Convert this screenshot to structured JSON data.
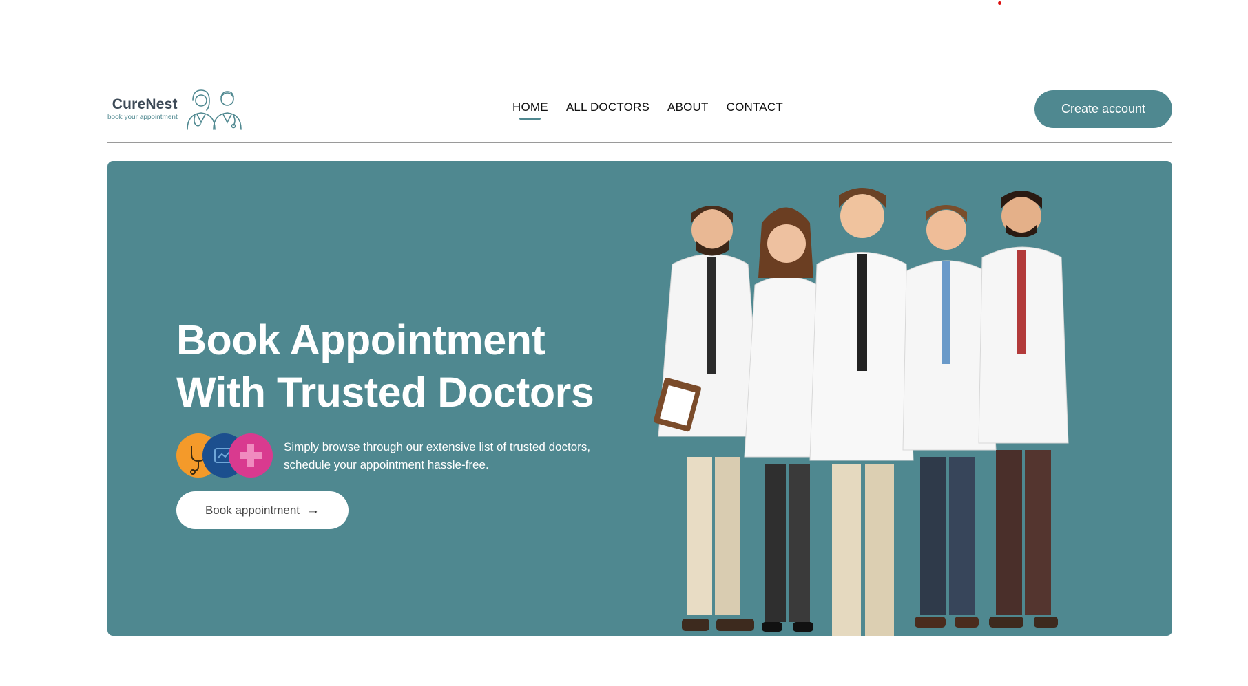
{
  "header": {
    "logo": {
      "name": "CureNest",
      "tagline": "book your appointment",
      "icon": "doctors-outline-icon"
    },
    "nav": [
      {
        "label": "HOME",
        "active": true
      },
      {
        "label": "ALL DOCTORS",
        "active": false
      },
      {
        "label": "ABOUT",
        "active": false
      },
      {
        "label": "CONTACT",
        "active": false
      }
    ],
    "create_account_label": "Create account"
  },
  "hero": {
    "title_line1": "Book Appointment",
    "title_line2": "With Trusted Doctors",
    "description_line1": "Simply browse through our extensive list of trusted doctors,",
    "description_line2": "schedule your appointment hassle-free.",
    "group_icon": "medical-icons-group",
    "book_label": "Book appointment",
    "book_icon": "arrow-right-icon",
    "illustration": "doctors-team-illustration"
  },
  "colors": {
    "primary": "#4f8890",
    "orange": "#f49a2a",
    "blue": "#1c4f8e",
    "pink": "#d93a8f",
    "white": "#ffffff"
  }
}
